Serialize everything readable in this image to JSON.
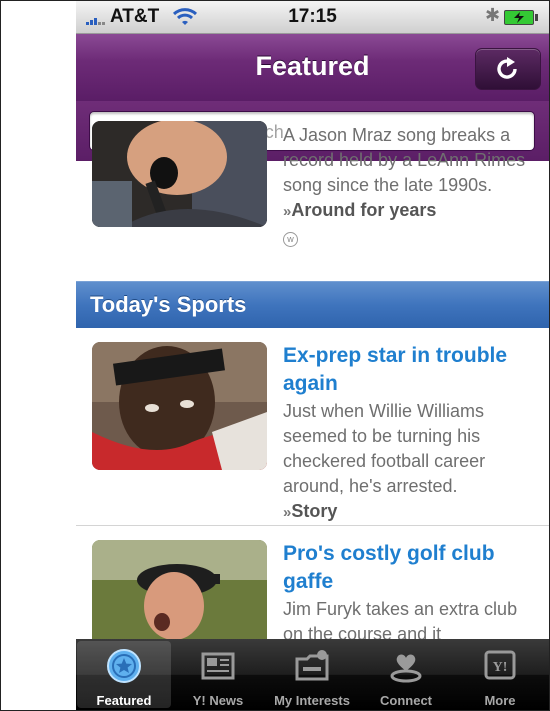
{
  "status_bar": {
    "carrier": "AT&T",
    "time": "17:15",
    "bluetooth_icon": "bluetooth-icon",
    "battery_state": "charging"
  },
  "header": {
    "title": "Featured",
    "refresh_icon": "refresh-icon"
  },
  "search": {
    "placeholder": "Yahoo! oneSearch",
    "value": ""
  },
  "top_story": {
    "text": "A Jason Mraz song breaks a record held by a LeAnn Rimes song since the late 1990s.",
    "link_label": "Around for years",
    "source_badge": "w"
  },
  "section": {
    "title": "Today's Sports"
  },
  "stories": [
    {
      "headline": "Ex-prep star in trouble again",
      "summary": "Just when Willie Williams seemed to be turning his checkered football career around, he's arrested.",
      "link_label": "Story"
    },
    {
      "headline": "Pro's costly golf club gaffe",
      "summary": "Jim Furyk takes an extra club on the course and it"
    }
  ],
  "tabbar": {
    "tabs": [
      {
        "label": "Featured",
        "icon": "star-badge-icon",
        "active": true
      },
      {
        "label": "Y! News",
        "icon": "newspaper-icon",
        "active": false
      },
      {
        "label": "My Interests",
        "icon": "folder-icon",
        "active": false
      },
      {
        "label": "Connect",
        "icon": "connect-heart-icon",
        "active": false
      },
      {
        "label": "More",
        "icon": "yahoo-logo-icon",
        "active": false
      }
    ]
  },
  "colors": {
    "header_purple": "#6d2b77",
    "section_blue": "#3f74bd",
    "headline_blue": "#1f7fcf"
  }
}
